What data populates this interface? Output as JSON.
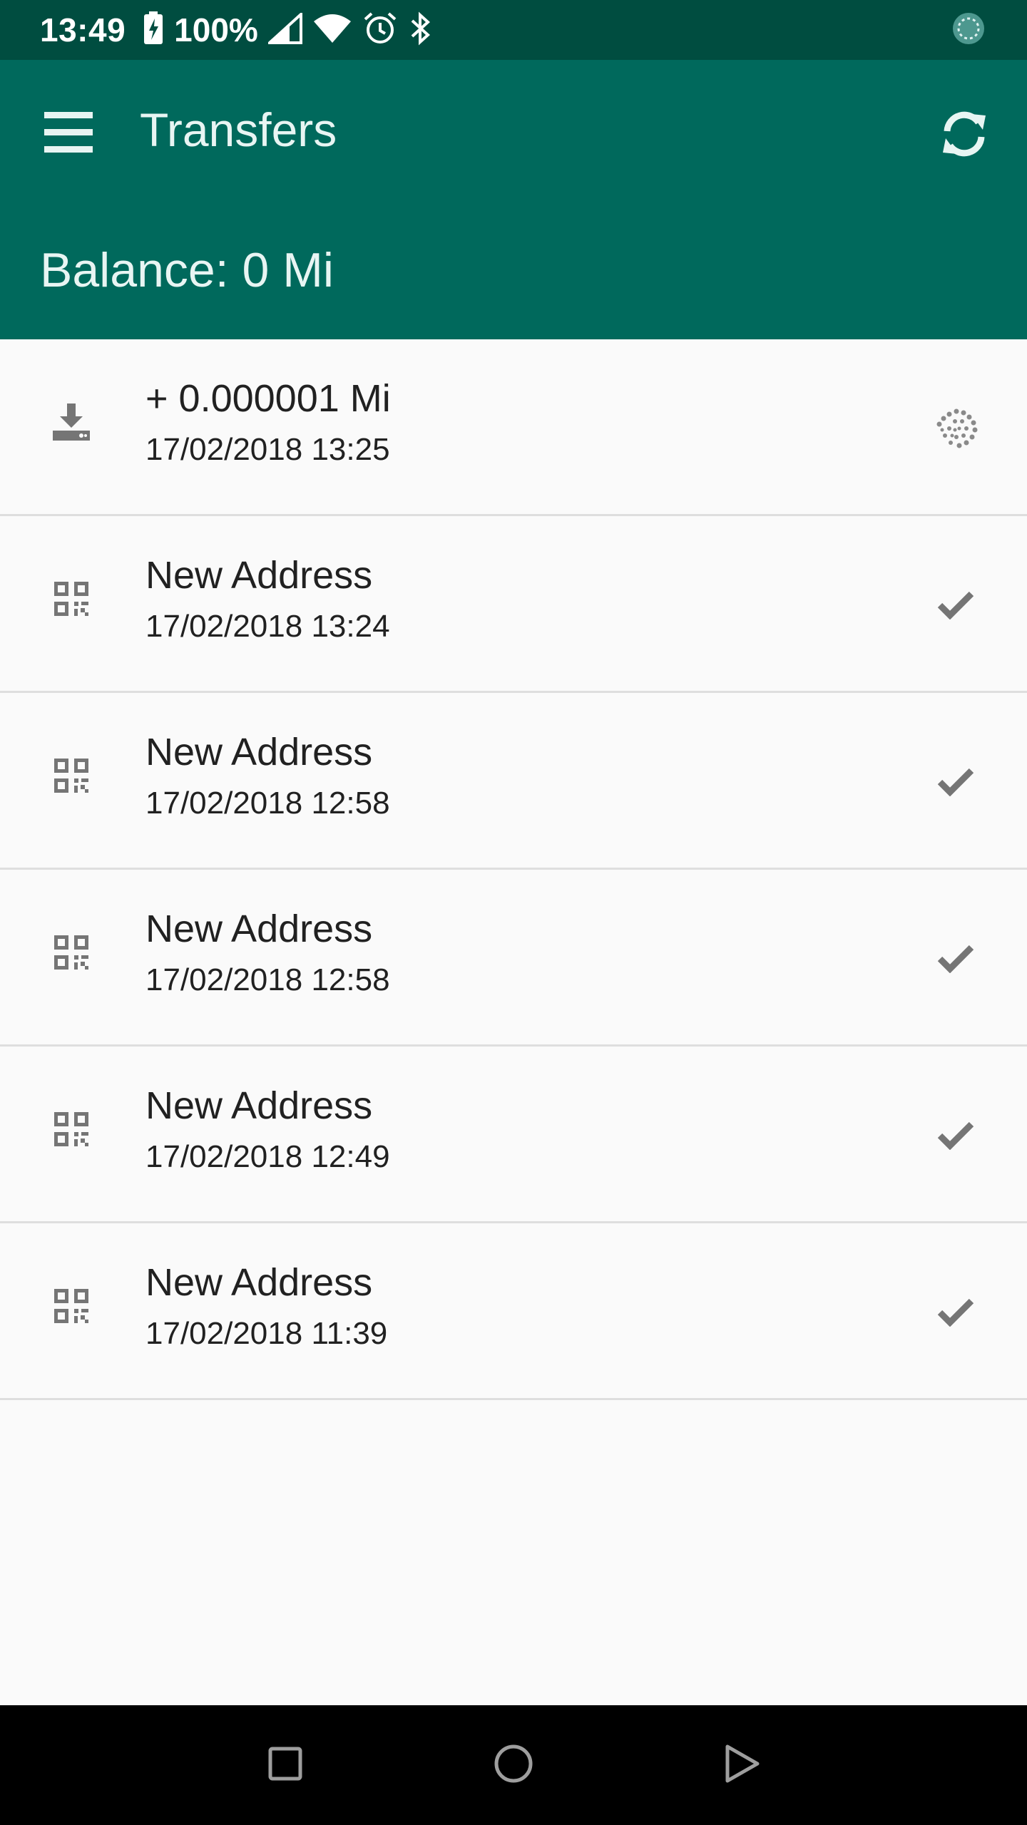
{
  "status_bar": {
    "time": "13:49",
    "battery": "100%",
    "icons": [
      "battery-charging-icon",
      "signal-icon",
      "wifi-icon",
      "alarm-icon",
      "bluetooth-icon",
      "sync-loading-icon"
    ]
  },
  "app_bar": {
    "title": "Transfers",
    "balance": "Balance: 0 Mi",
    "menu_icon": "menu-icon",
    "refresh_icon": "refresh-icon"
  },
  "transfers": [
    {
      "title": "+ 0.000001 Mi",
      "time": "17/02/2018 13:25",
      "leading_icon": "receive-download-icon",
      "status_icon": "iota-pending-icon"
    },
    {
      "title": "New Address",
      "time": "17/02/2018 13:24",
      "leading_icon": "qr-code-icon",
      "status_icon": "check-icon"
    },
    {
      "title": "New Address",
      "time": "17/02/2018 12:58",
      "leading_icon": "qr-code-icon",
      "status_icon": "check-icon"
    },
    {
      "title": "New Address",
      "time": "17/02/2018 12:58",
      "leading_icon": "qr-code-icon",
      "status_icon": "check-icon"
    },
    {
      "title": "New Address",
      "time": "17/02/2018 12:49",
      "leading_icon": "qr-code-icon",
      "status_icon": "check-icon"
    },
    {
      "title": "New Address",
      "time": "17/02/2018 11:39",
      "leading_icon": "qr-code-icon",
      "status_icon": "check-icon"
    }
  ],
  "colors": {
    "status_bar": "#004d40",
    "app_bar": "#00695c",
    "background": "#fafafa",
    "icon_gray": "#757575"
  },
  "nav_bar": {
    "icons": [
      "recents-square-icon",
      "home-circle-icon",
      "back-triangle-icon"
    ]
  }
}
